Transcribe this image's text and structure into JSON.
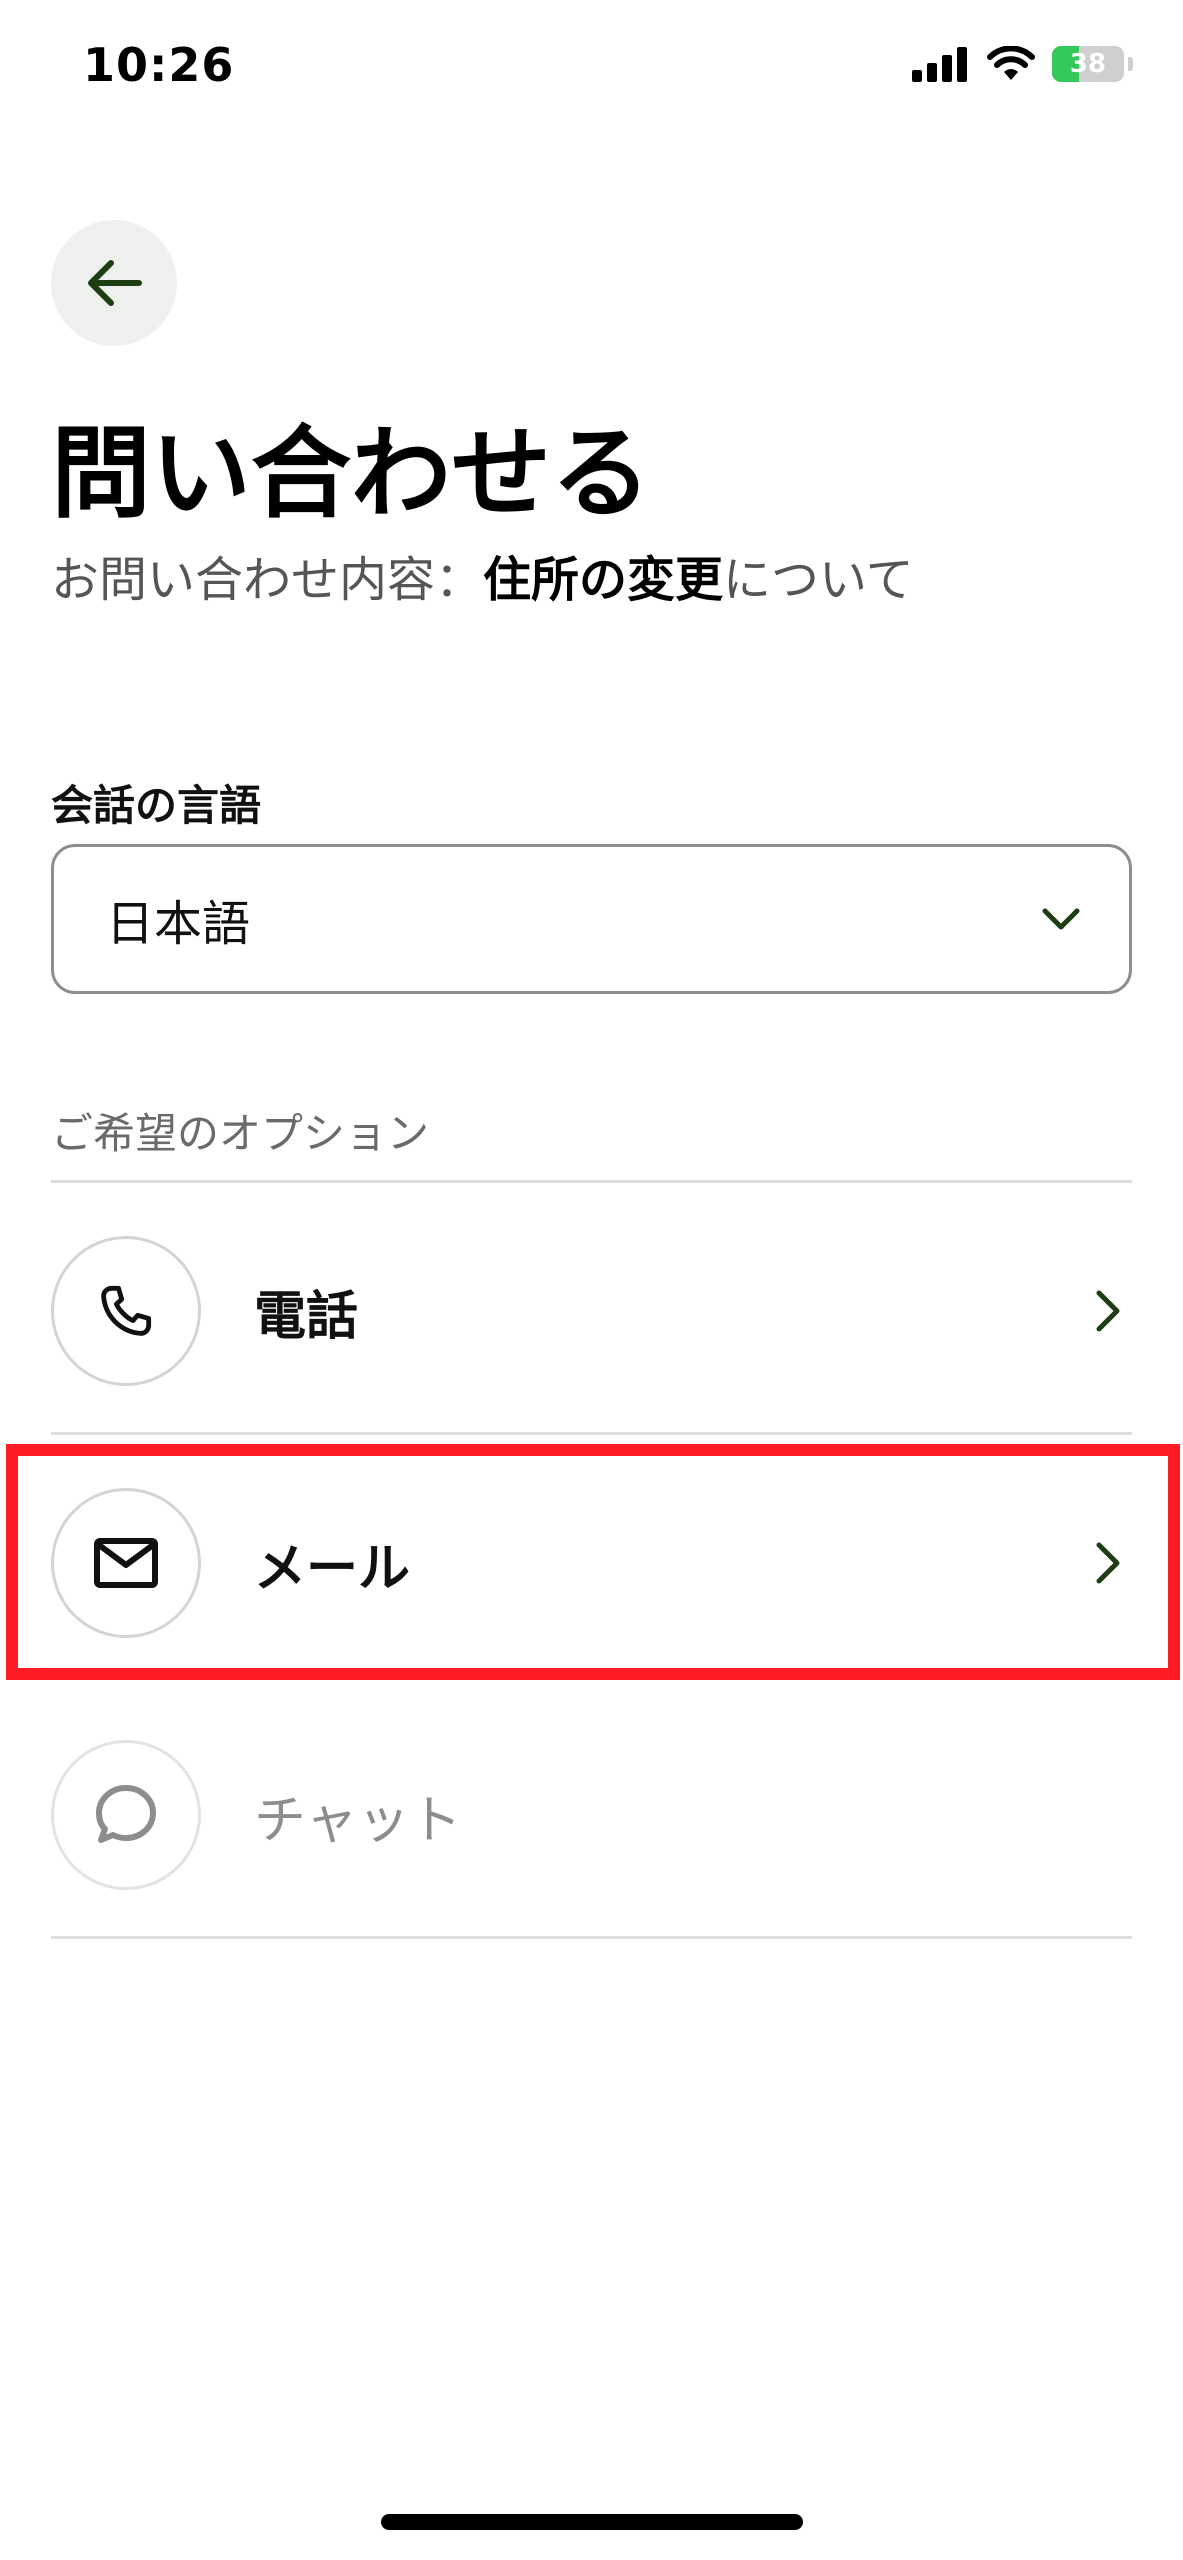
{
  "status_bar": {
    "time": "10:26",
    "battery_percent": "38",
    "icons": [
      "signal-icon",
      "wifi-icon",
      "battery-icon"
    ]
  },
  "header": {
    "back_icon": "arrow-left-icon",
    "title": "問い合わせる",
    "subtitle_prefix": "お問い合わせ内容：",
    "subtitle_topic": "住所の変更",
    "subtitle_suffix": "について"
  },
  "language": {
    "label": "会話の言語",
    "selected": "日本語",
    "icon": "chevron-down-icon"
  },
  "options": {
    "label": "ご希望のオプション",
    "items": [
      {
        "label": "電話",
        "icon": "phone-icon",
        "enabled": true
      },
      {
        "label": "メール",
        "icon": "mail-icon",
        "enabled": true,
        "highlighted": true
      },
      {
        "label": "チャット",
        "icon": "chat-bubble-icon",
        "enabled": false
      }
    ]
  },
  "colors": {
    "accent_dark_green": "#1f3d12",
    "highlight_red": "#ff1d25",
    "battery_green": "#34c759",
    "back_button_bg": "#eef0ed"
  }
}
